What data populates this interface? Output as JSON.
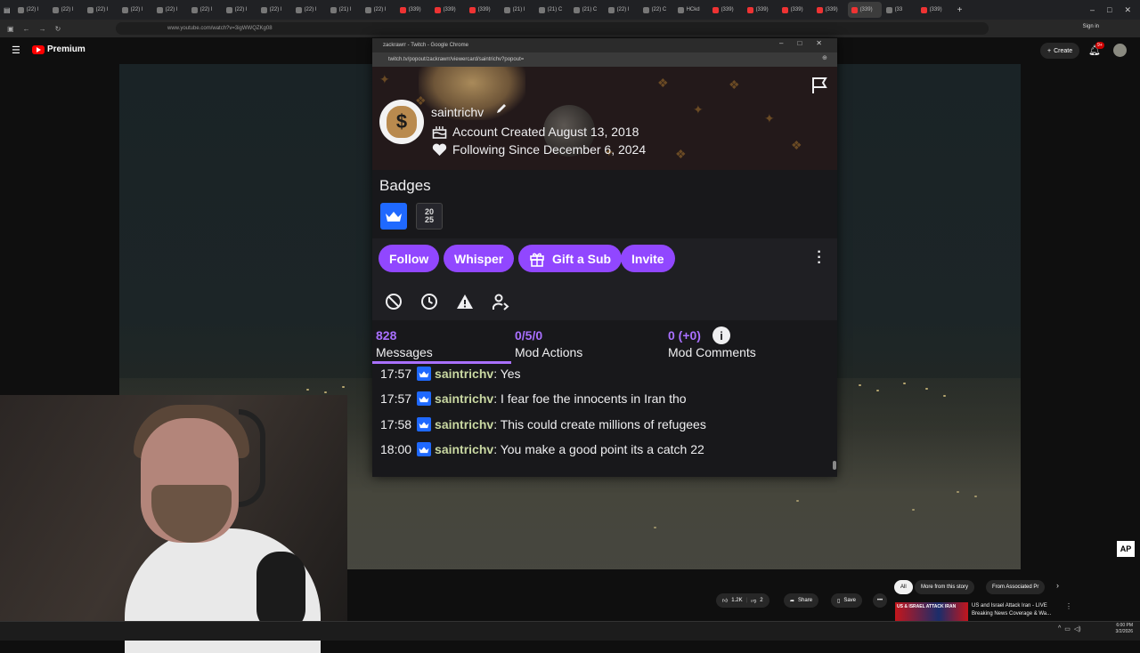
{
  "browser": {
    "tabs": [
      "(22) I",
      "(22) I",
      "(22) I",
      "(22) I",
      "(22) I",
      "(22) I",
      "(22) I",
      "(22) I",
      "(22) I",
      "(21) I",
      "(22) I",
      "(339)",
      "(339)",
      "(339)",
      "(21) I",
      "(21) C",
      "(21) C",
      "(22) I",
      "(22) C",
      "HCkd",
      "(339)",
      "(339)",
      "(339)",
      "(339)",
      "(339)",
      "(33",
      "(339)"
    ],
    "url": "www.youtube.com/watch?v=3igWWQZKg08",
    "sign_in": "Sign in"
  },
  "youtube": {
    "logo_text": "Premium",
    "create_label": "Create",
    "notif_count": "9+",
    "likes": "1.2K",
    "dislikes": "2",
    "share_label": "Share",
    "save_label": "Save",
    "more_label": "•••",
    "chips": [
      "All",
      "More from this story",
      "From Associated Pr"
    ],
    "ap_badge": "AP",
    "recommendation": {
      "thumb_text": "US & ISRAEL ATTACK IRAN",
      "title": "US and Israel Attack Iran - LIVE Breaking News Coverage & Wa..."
    }
  },
  "taskbar": {
    "time": "6:00 PM",
    "date": "3/2/2026"
  },
  "popup": {
    "window_title": "zackrawrr - Twitch - Google Chrome",
    "url": "twitch.tv/popout/zackrawrr/viewercard/saintrichv?popout=",
    "user": {
      "username": "saintrichv",
      "account_created": "Account Created August 13, 2018",
      "following_since": "Following Since December 6, 2024"
    },
    "badges_title": "Badges",
    "badge_year_top": "20",
    "badge_year_bottom": "25",
    "buttons": {
      "follow": "Follow",
      "whisper": "Whisper",
      "gift": "Gift a Sub",
      "invite": "Invite"
    },
    "stats": {
      "messages_count": "828",
      "messages_label": "Messages",
      "mod_actions_count": "0/5/0",
      "mod_actions_label": "Mod Actions",
      "mod_comments_count": "0 (+0)",
      "mod_comments_label": "Mod Comments"
    },
    "chat": [
      {
        "time": "17:57",
        "user": "saintrichv",
        "text": ": Yes"
      },
      {
        "time": "17:57",
        "user": "saintrichv",
        "text": ": I fear foe the innocents in Iran tho"
      },
      {
        "time": "17:58",
        "user": "saintrichv",
        "text": ": This could create millions of refugees"
      },
      {
        "time": "18:00",
        "user": "saintrichv",
        "text": ": You make a good point its a catch 22"
      }
    ]
  },
  "colors": {
    "twitch_purple": "#9147ff",
    "twitch_accent": "#a970ff",
    "sub_badge_blue": "#1f69ff",
    "youtube_red": "#ff0000"
  }
}
